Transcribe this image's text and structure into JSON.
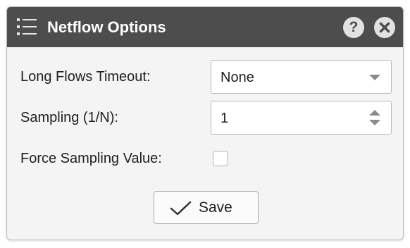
{
  "dialog": {
    "title": "Netflow Options",
    "icons": {
      "menu": "list-icon",
      "help": "help-icon",
      "close": "close-icon"
    },
    "help_glyph": "?"
  },
  "form": {
    "long_flows_timeout": {
      "label": "Long Flows Timeout:",
      "value": "None"
    },
    "sampling": {
      "label": "Sampling (1/N):",
      "value": "1"
    },
    "force_sampling": {
      "label": "Force Sampling Value:",
      "checked": false
    }
  },
  "actions": {
    "save_label": "Save",
    "save_icon": "checkmark-icon"
  },
  "colors": {
    "titlebar": "#4d4d4d",
    "dialog_bg": "#f4f4f4",
    "icon_light": "#e2e2e2"
  }
}
